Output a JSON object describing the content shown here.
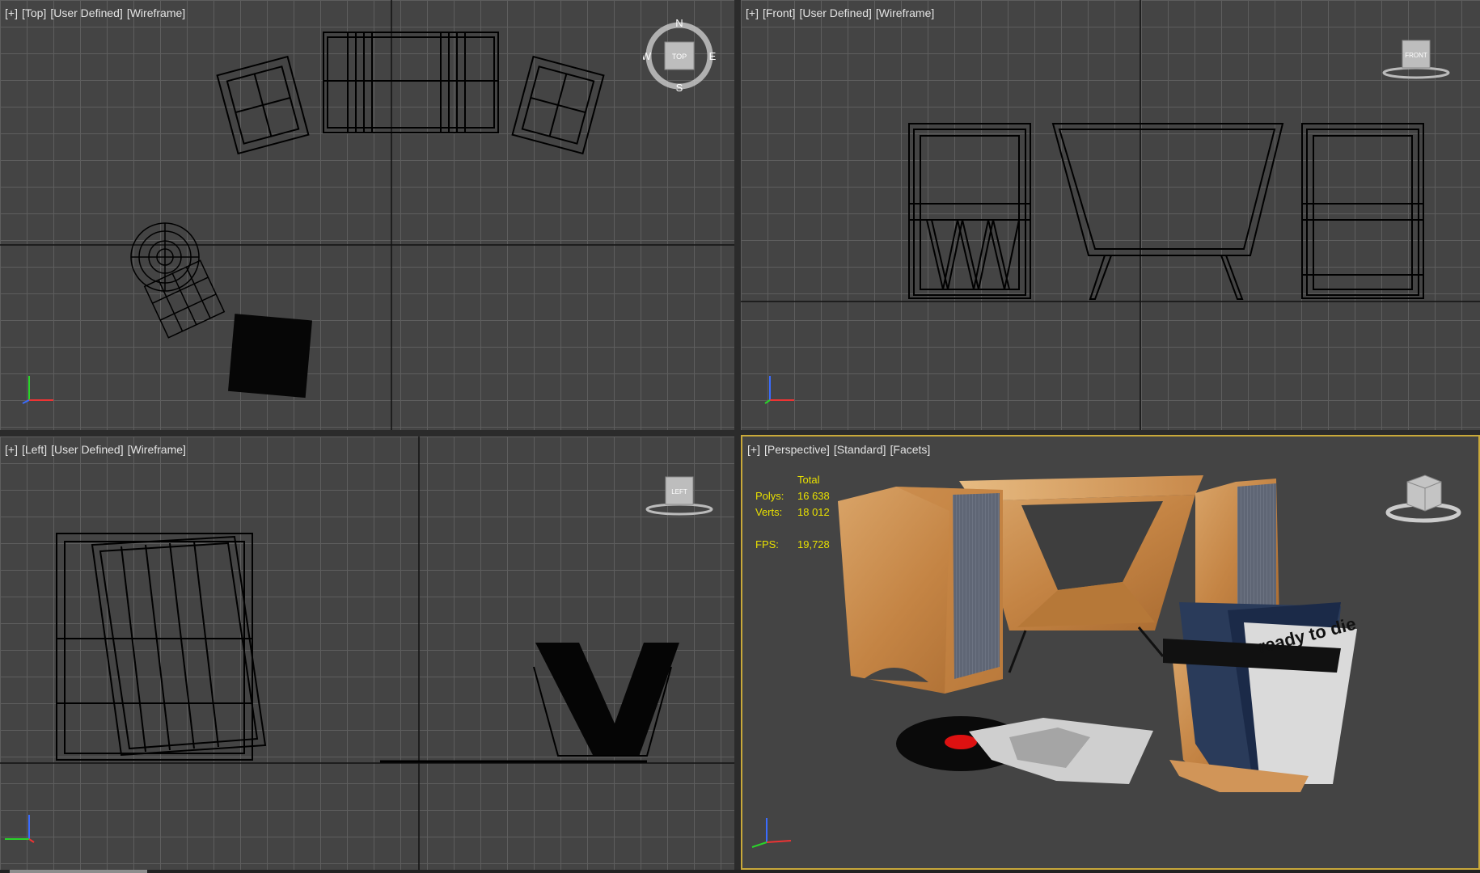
{
  "viewports": {
    "top": {
      "labels": [
        "[+]",
        "[Top]",
        "[User Defined]",
        "[Wireframe]"
      ],
      "navcube_face": "TOP",
      "compass": {
        "n": "N",
        "s": "S",
        "e": "E",
        "w": "W"
      }
    },
    "front": {
      "labels": [
        "[+]",
        "[Front]",
        "[User Defined]",
        "[Wireframe]"
      ],
      "navcube_face": "FRONT"
    },
    "left": {
      "labels": [
        "[+]",
        "[Left]",
        "[User Defined]",
        "[Wireframe]"
      ],
      "navcube_face": "LEFT"
    },
    "perspective": {
      "labels": [
        "[+]",
        "[Perspective]",
        "[Standard]",
        "[Facets]"
      ],
      "stats": {
        "header": "Total",
        "polys_label": "Polys:",
        "polys_value": "16 638",
        "verts_label": "Verts:",
        "verts_value": "18 012",
        "fps_label": "FPS:",
        "fps_value": "19,728"
      },
      "album_text": "ready to die"
    }
  },
  "colors": {
    "viewport_bg": "#444444",
    "grid": "#5e5e5e",
    "active_border": "#c9a93a",
    "stats_text": "#e8e000",
    "wood": "#c98c4c"
  }
}
